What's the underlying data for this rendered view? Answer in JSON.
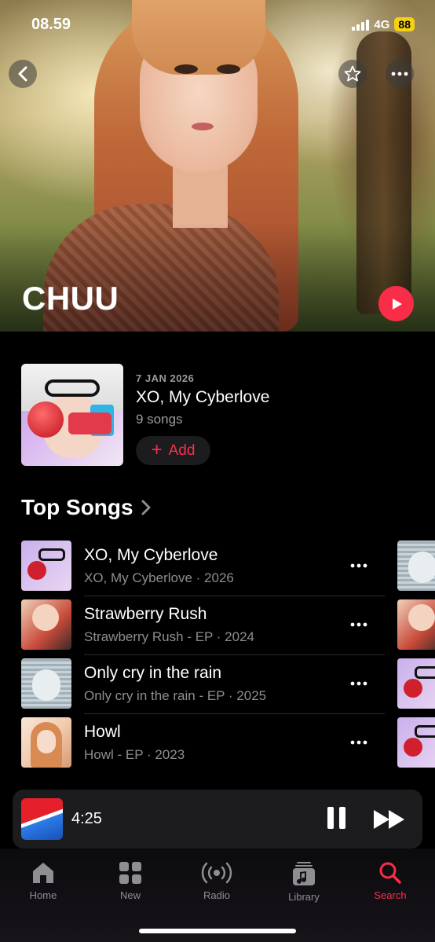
{
  "status_bar": {
    "time": "08.59",
    "network": "4G",
    "battery": "88"
  },
  "artist": {
    "name": "CHUU"
  },
  "latest_release": {
    "date": "7 JAN 2026",
    "title": "XO, My Cyberlove",
    "song_count": "9 songs",
    "add_label": "Add"
  },
  "top_songs": {
    "header": "Top Songs",
    "items": [
      {
        "title": "XO, My Cyberlove",
        "subtitle": "XO, My Cyberlove · 2026"
      },
      {
        "title": "Strawberry Rush",
        "subtitle": "Strawberry Rush - EP · 2024"
      },
      {
        "title": "Only cry in the rain",
        "subtitle": "Only cry in the rain - EP · 2025"
      },
      {
        "title": "Howl",
        "subtitle": "Howl - EP · 2023"
      }
    ]
  },
  "mini_player": {
    "time": "4:25"
  },
  "tabs": [
    {
      "label": "Home",
      "icon": "home-icon"
    },
    {
      "label": "New",
      "icon": "grid-icon"
    },
    {
      "label": "Radio",
      "icon": "radio-icon"
    },
    {
      "label": "Library",
      "icon": "library-icon"
    },
    {
      "label": "Search",
      "icon": "search-icon",
      "active": true
    }
  ],
  "colors": {
    "accent": "#fa2d48",
    "background": "#000000",
    "secondary_text": "#8e8e93",
    "battery": "#f5d015"
  }
}
